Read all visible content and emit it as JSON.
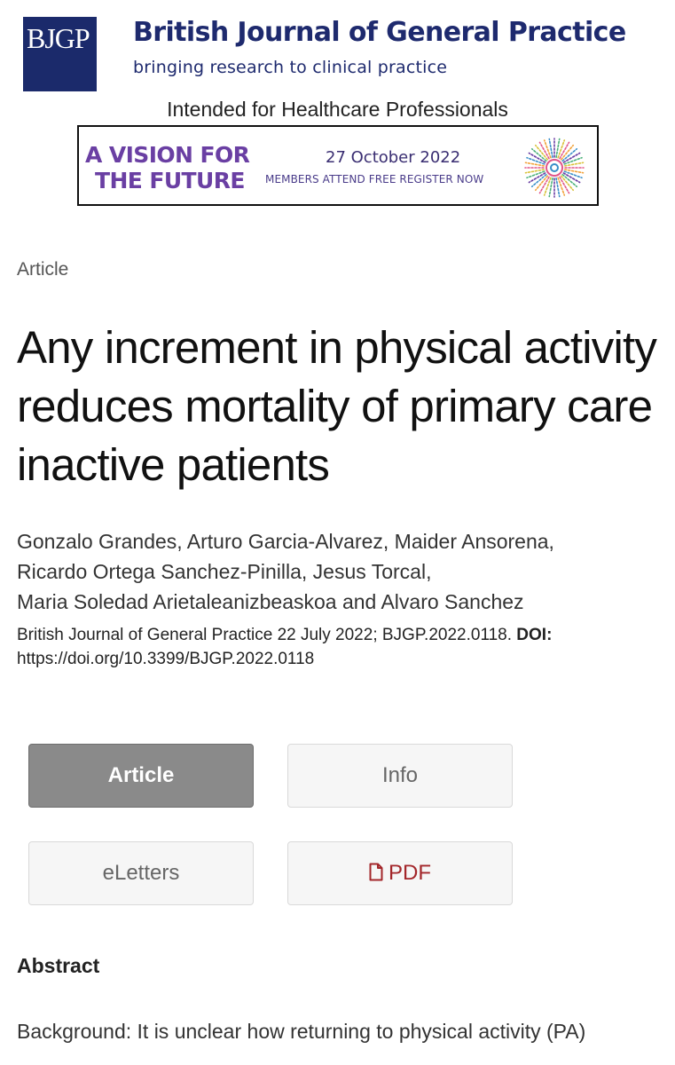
{
  "header": {
    "logo_text": "BJGP",
    "journal_name": "British Journal of General Practice",
    "tagline": "bringing research to clinical practice",
    "audience_notice": "Intended for Healthcare Professionals"
  },
  "banner": {
    "title_line1": "A VISION FOR",
    "title_line2": "THE FUTURE",
    "date": "27 October 2022",
    "cta": "MEMBERS ATTEND FREE REGISTER NOW",
    "colors": {
      "title": "#6a3fa3",
      "text": "#3a2e72"
    }
  },
  "article": {
    "type_label": "Article",
    "title": "Any increment in physical activity reduces mortality of primary care inactive patients",
    "authors_line1": "Gonzalo Grandes, Arturo Garcia-Alvarez, Maider Ansorena,",
    "authors_line2": "Ricardo Ortega Sanchez-Pinilla, Jesus Torcal,",
    "authors_line3": "Maria Soledad Arietaleanizbeaskoa and Alvaro Sanchez",
    "citation": "British Journal of General Practice 22 July 2022; BJGP.2022.0118.",
    "doi_label": "DOI:",
    "doi_url": "https://doi.org/10.3399/BJGP.2022.0118"
  },
  "tabs": {
    "article": "Article",
    "info": "Info",
    "eletters": "eLetters",
    "pdf": "PDF",
    "pdf_icon": "document-icon"
  },
  "abstract": {
    "heading": "Abstract",
    "line1": "Background: It is unclear how returning to physical activity (PA)"
  },
  "colors": {
    "brand_navy": "#1e2a6e",
    "active_tab": "#8a8a8a",
    "pdf_red": "#a3262a"
  }
}
